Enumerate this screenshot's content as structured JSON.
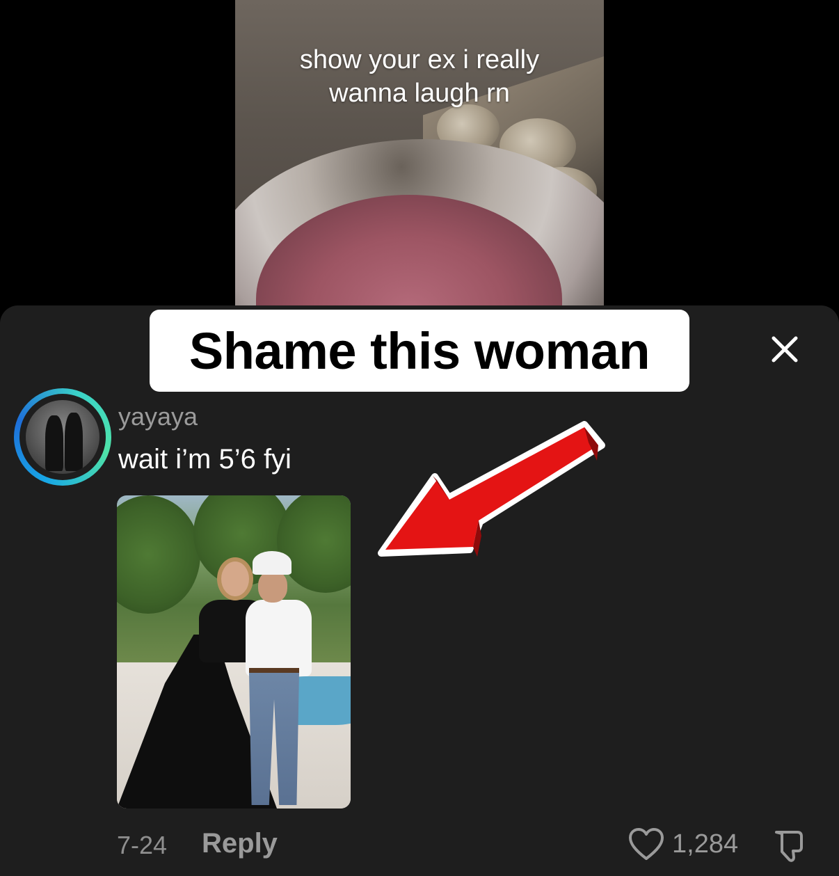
{
  "video": {
    "caption_line1": "show your ex i really",
    "caption_line2": "wanna laugh rn"
  },
  "banner": {
    "text": "Shame this woman"
  },
  "comment": {
    "username": "yayaya",
    "text": "wait i’m 5’6 fyi",
    "date": "7-24",
    "reply_label": "Reply",
    "like_count": "1,284"
  },
  "icons": {
    "close": "close-icon",
    "like": "heart-icon",
    "dislike": "thumbs-down-icon",
    "arrow": "red-arrow-icon"
  },
  "colors": {
    "sheet_bg": "#1e1e1e",
    "arrow": "#e41414",
    "avatar_ring_start": "#18a7e6",
    "avatar_ring_end": "#4fe3a8"
  }
}
